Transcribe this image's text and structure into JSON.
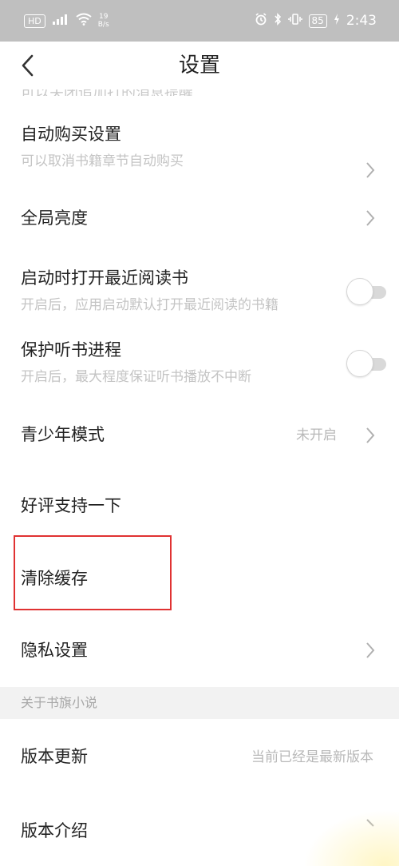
{
  "status_bar": {
    "hd_badge": "HD",
    "signal_label": "⁴⁶ᵢₗ",
    "speed_top": "19",
    "speed_bottom": "B/s",
    "battery": "85",
    "time": "2:43"
  },
  "header": {
    "title": "设置"
  },
  "settings": {
    "clipped_text": "可以关闭追加打的消息提醒",
    "auto_buy": {
      "title": "自动购买设置",
      "subtitle": "可以取消书籍章节自动购买"
    },
    "brightness": {
      "title": "全局亮度"
    },
    "open_recent": {
      "title": "启动时打开最近阅读书",
      "subtitle": "开启后，应用启动默认打开最近阅读的书籍",
      "enabled": false
    },
    "protect_audio": {
      "title": "保护听书进程",
      "subtitle": "开启后，最大程度保证听书播放不中断",
      "enabled": false
    },
    "youth_mode": {
      "title": "青少年模式",
      "value": "未开启"
    },
    "rate_us": {
      "title": "好评支持一下"
    },
    "clear_cache": {
      "title": "清除缓存"
    },
    "privacy": {
      "title": "隐私设置"
    }
  },
  "about": {
    "section_title": "关于书旗小说",
    "version_update": {
      "title": "版本更新",
      "value": "当前已经是最新版本"
    },
    "version_intro": {
      "title": "版本介绍"
    }
  },
  "colors": {
    "highlight_border": "#e03232",
    "status_bar_bg": "#bfbfbf",
    "title_text": "#222222",
    "subtitle_text": "#c4c4c4"
  }
}
